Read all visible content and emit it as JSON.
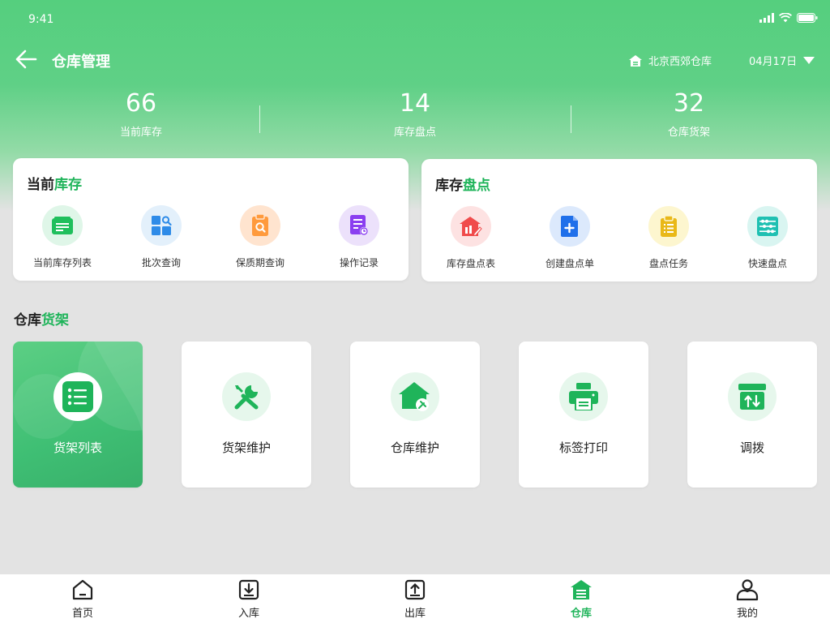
{
  "status_bar": {
    "time": "9:41"
  },
  "header": {
    "title": "仓库管理",
    "location": "北京西郊仓库",
    "date": "04月17日"
  },
  "stats": [
    {
      "value": "66",
      "label": "当前库存"
    },
    {
      "value": "14",
      "label": "库存盘点"
    },
    {
      "value": "32",
      "label": "仓库货架"
    }
  ],
  "inventory_card": {
    "title_part1": "当前",
    "title_part2": "库存",
    "items": [
      {
        "label": "当前库存列表",
        "icon": "list-doc-icon"
      },
      {
        "label": "批次查询",
        "icon": "grid-search-icon"
      },
      {
        "label": "保质期查询",
        "icon": "clipboard-search-icon"
      },
      {
        "label": "操作记录",
        "icon": "doc-clock-icon"
      }
    ]
  },
  "stocktake_card": {
    "title_part1": "库存",
    "title_part2": "盘点",
    "items": [
      {
        "label": "库存盘点表",
        "icon": "warehouse-edit-icon"
      },
      {
        "label": "创建盘点单",
        "icon": "file-plus-icon"
      },
      {
        "label": "盘点任务",
        "icon": "clipboard-list-icon"
      },
      {
        "label": "快速盘点",
        "icon": "abacus-icon"
      }
    ]
  },
  "shelves_section": {
    "title_part1": "仓库",
    "title_part2": "货架",
    "tiles": [
      {
        "label": "货架列表",
        "icon": "list-icon",
        "active": true
      },
      {
        "label": "货架维护",
        "icon": "tools-icon"
      },
      {
        "label": "仓库维护",
        "icon": "house-tool-icon"
      },
      {
        "label": "标签打印",
        "icon": "printer-icon"
      },
      {
        "label": "调拨",
        "icon": "transfer-box-icon"
      }
    ]
  },
  "tabbar": [
    {
      "label": "首页",
      "icon": "home-icon"
    },
    {
      "label": "入库",
      "icon": "inbound-icon"
    },
    {
      "label": "出库",
      "icon": "outbound-icon"
    },
    {
      "label": "仓库",
      "icon": "warehouse-icon",
      "active": true
    },
    {
      "label": "我的",
      "icon": "user-icon"
    }
  ],
  "colors": {
    "brand_green": "#1fb45a",
    "header_green": "#55cf7e",
    "background": "#e3e3e3"
  }
}
